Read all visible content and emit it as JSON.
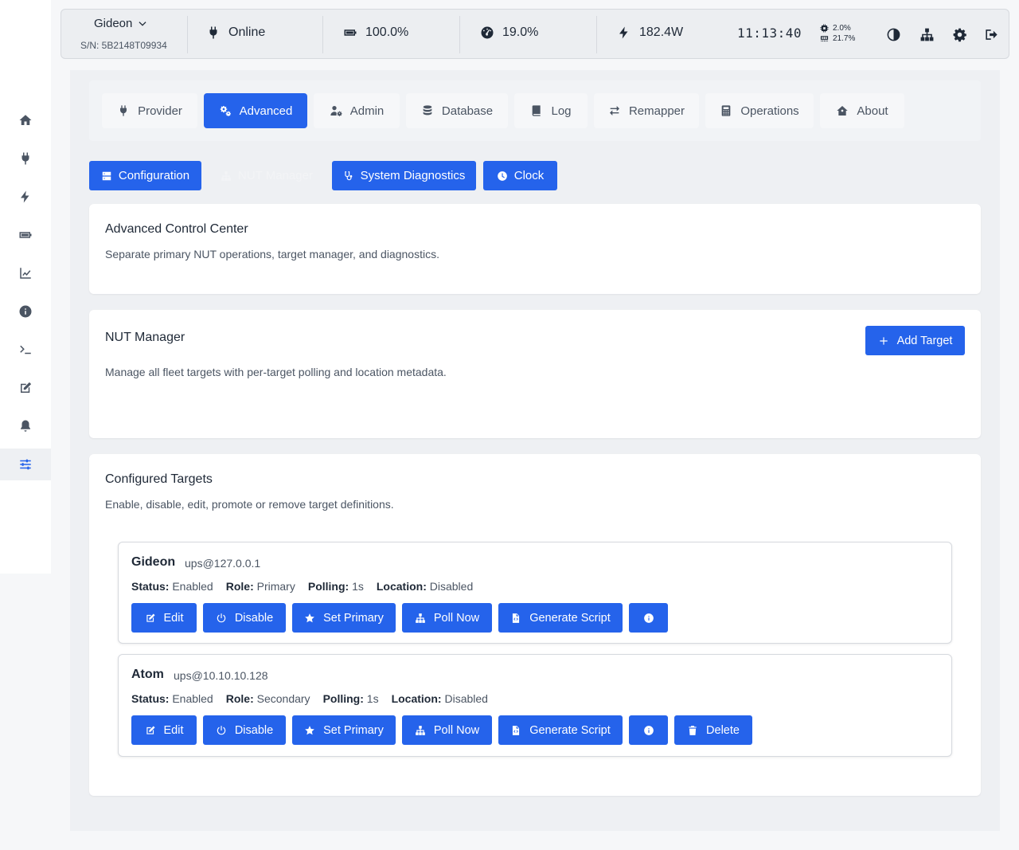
{
  "sidebar": {
    "items": [
      {
        "name": "home",
        "icon": "home-icon"
      },
      {
        "name": "provider",
        "icon": "plug-icon"
      },
      {
        "name": "power",
        "icon": "bolt-icon"
      },
      {
        "name": "battery",
        "icon": "battery-icon"
      },
      {
        "name": "charts",
        "icon": "chart-line-icon"
      },
      {
        "name": "info",
        "icon": "info-circle-icon"
      },
      {
        "name": "terminal",
        "icon": "terminal-icon"
      },
      {
        "name": "edit",
        "icon": "edit-icon"
      },
      {
        "name": "notifications",
        "icon": "bell-icon"
      },
      {
        "name": "settings",
        "icon": "sliders-icon",
        "active": true
      }
    ]
  },
  "header": {
    "device_name": "Gideon",
    "serial": "S/N: 5B2148T09934",
    "status": "Online",
    "battery": "100.0%",
    "load": "19.0%",
    "power": "182.4W",
    "clock": "11:13:40",
    "cpu": "2.0%",
    "memory": "21.7%"
  },
  "tabs": [
    {
      "label": "Provider",
      "icon": "plug-icon"
    },
    {
      "label": "Advanced",
      "icon": "cogs-icon",
      "active": true
    },
    {
      "label": "Admin",
      "icon": "user-cog-icon"
    },
    {
      "label": "Database",
      "icon": "database-icon"
    },
    {
      "label": "Log",
      "icon": "book-icon"
    },
    {
      "label": "Remapper",
      "icon": "exchange-icon"
    },
    {
      "label": "Operations",
      "icon": "calculator-icon"
    },
    {
      "label": "About",
      "icon": "house-icon"
    }
  ],
  "subtabs": [
    {
      "label": "Configuration",
      "icon": "server-icon"
    },
    {
      "label": "NUT Manager",
      "icon": "network-icon",
      "active": true
    },
    {
      "label": "System Diagnostics",
      "icon": "stethoscope-icon"
    },
    {
      "label": "Clock",
      "icon": "clock-icon"
    }
  ],
  "control_center": {
    "title": "Advanced Control Center",
    "subtitle": "Separate primary NUT operations, target manager, and diagnostics."
  },
  "nut_manager": {
    "title": "NUT Manager",
    "subtitle": "Manage all fleet targets with per-target polling and location metadata.",
    "add_label": "Add Target"
  },
  "configured": {
    "title": "Configured Targets",
    "subtitle": "Enable, disable, edit, promote or remove target definitions.",
    "labels": {
      "status": "Status:",
      "role": "Role:",
      "polling": "Polling:",
      "location": "Location:"
    },
    "actions": {
      "edit": "Edit",
      "disable": "Disable",
      "set_primary": "Set Primary",
      "poll_now": "Poll Now",
      "generate_script": "Generate Script",
      "delete": "Delete"
    },
    "targets": [
      {
        "name": "Gideon",
        "address": "ups@127.0.0.1",
        "status": "Enabled",
        "role": "Primary",
        "polling": "1s",
        "location": "Disabled"
      },
      {
        "name": "Atom",
        "address": "ups@10.10.10.128",
        "status": "Enabled",
        "role": "Secondary",
        "polling": "1s",
        "location": "Disabled"
      }
    ]
  },
  "colors": {
    "accent": "#2563eb",
    "panel": "#eef0f3"
  }
}
